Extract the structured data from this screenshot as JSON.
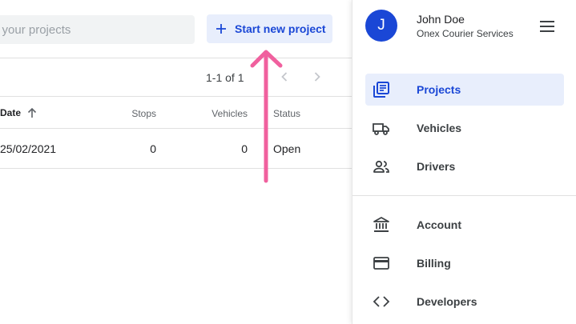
{
  "main": {
    "search": {
      "placeholder": "h your projects"
    },
    "new_project_button": {
      "label": "Start new project"
    },
    "pagination": {
      "range": "1-1 of 1"
    },
    "table": {
      "headers": {
        "date": "Date",
        "stops": "Stops",
        "vehicles": "Vehicles",
        "status": "Status"
      },
      "rows": [
        {
          "date": "25/02/2021",
          "stops": "0",
          "vehicles": "0",
          "status": "Open"
        }
      ]
    }
  },
  "drawer": {
    "user": {
      "initial": "J",
      "name": "John Doe",
      "organization": "Onex Courier Services"
    },
    "nav": [
      {
        "label": "Projects",
        "icon": "projects-icon",
        "active": true
      },
      {
        "label": "Vehicles",
        "icon": "truck-icon",
        "active": false
      },
      {
        "label": "Drivers",
        "icon": "people-icon",
        "active": false
      }
    ],
    "secondary_nav": [
      {
        "label": "Account",
        "icon": "bank-icon"
      },
      {
        "label": "Billing",
        "icon": "credit-card-icon"
      },
      {
        "label": "Developers",
        "icon": "code-icon"
      }
    ]
  },
  "colors": {
    "accent": "#1a47d6",
    "accent_bg": "#e8eefc",
    "annotation_arrow": "#f0609e"
  }
}
